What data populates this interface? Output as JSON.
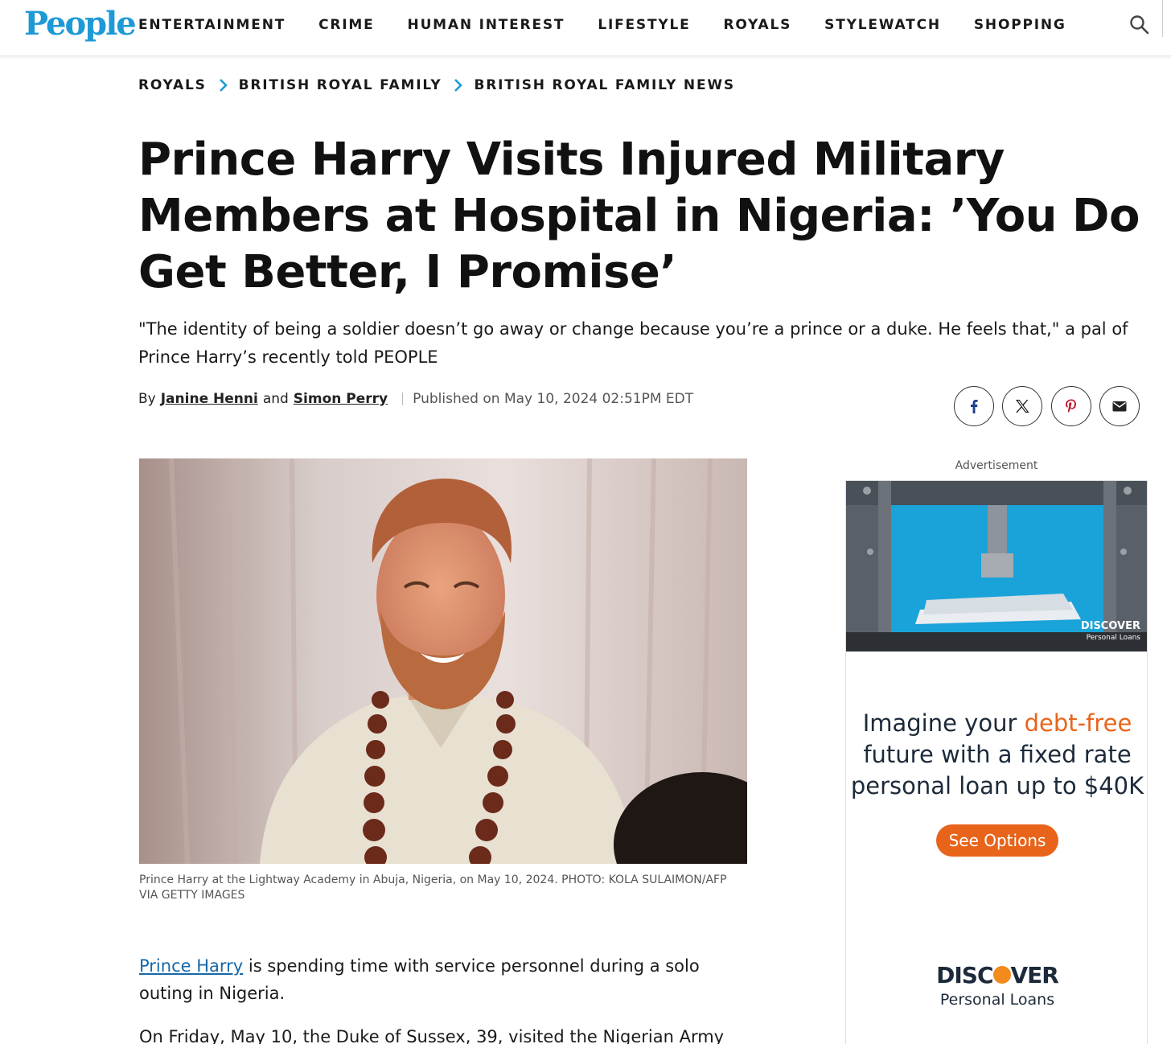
{
  "header": {
    "logo": "People",
    "nav": [
      "ENTERTAINMENT",
      "CRIME",
      "HUMAN INTEREST",
      "LIFESTYLE",
      "ROYALS",
      "STYLEWATCH",
      "SHOPPING"
    ],
    "search_icon": "search-icon"
  },
  "breadcrumb": [
    "ROYALS",
    "BRITISH ROYAL FAMILY",
    "BRITISH ROYAL FAMILY NEWS"
  ],
  "article": {
    "headline": "Prince Harry Visits Injured Military Members at Hospital in Nigeria: ’You Do Get Better, I Promise’",
    "dek": "\"The identity of being a soldier doesn’t go away or change because you’re a prince or a duke. He feels that,\" a pal of Prince Harry’s recently told PEOPLE",
    "byline": {
      "by": "By",
      "author1": "Janine Henni",
      "and": "and",
      "author2": "Simon Perry",
      "published": "Published on May 10, 2024 02:51PM EDT"
    },
    "share_icons": [
      "facebook-icon",
      "x-icon",
      "pinterest-icon",
      "email-icon"
    ],
    "caption": "Prince Harry at the Lightway Academy in Abuja, Nigeria, on May 10, 2024. PHOTO: KOLA SULAIMON/AFP VIA GETTY IMAGES",
    "para1_link": "Prince Harry",
    "para1_rest": " is spending time with service personnel during a solo outing in Nigeria.",
    "para2": "On Friday, May 10, the Duke of Sussex, 39, visited the Nigerian Army"
  },
  "ad": {
    "label": "Advertisement",
    "top_brand": "DISCOVER",
    "top_brand_sub": "Personal Loans",
    "text_pre": "Imagine your ",
    "text_hl": "debt-free",
    "text_post": " future with a fixed rate personal loan up to $40K",
    "button": "See Options",
    "brand_pre": "DISC",
    "brand_post": "VER",
    "brand_sub": "Personal Loans"
  },
  "colors": {
    "brand": "#1d9ad6",
    "link": "#1668a8",
    "ad_accent": "#e8641b"
  }
}
